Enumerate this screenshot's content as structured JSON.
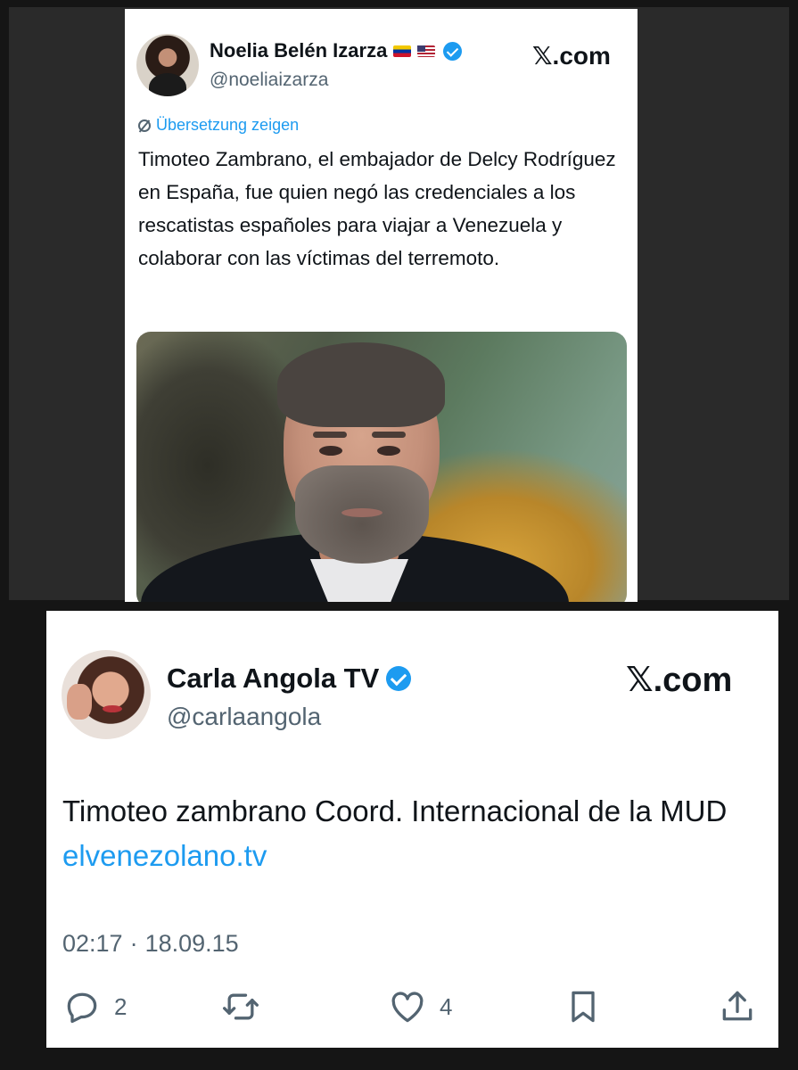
{
  "tweet_top": {
    "display_name": "Noelia Belén Izarza",
    "flags": [
      "venezuela-flag",
      "usa-flag"
    ],
    "handle": "@noeliaizarza",
    "source": "𝕏.com",
    "translate_label": "Übersetzung zeigen",
    "text": "Timoteo Zambrano, el embajador de Delcy Rodríguez en España, fue quien negó las credenciales a los rescatistas españoles para viajar a Venezuela y colaborar con las víctimas del terremoto.",
    "verified": true
  },
  "tweet_bottom": {
    "display_name": "Carla Angola TV",
    "handle": "@carlaangola",
    "source": "𝕏.com",
    "text": "Timoteo zambrano Coord. Internacional de la MUD",
    "link": "elvenezolano.tv",
    "time": "02:17",
    "separator": "·",
    "date": "18.09.15",
    "verified": true,
    "actions": {
      "reply_count": "2",
      "like_count": "4"
    }
  },
  "colors": {
    "accent": "#1d9bf0",
    "text": "#0f1419",
    "muted": "#536471",
    "background": "#151515"
  }
}
